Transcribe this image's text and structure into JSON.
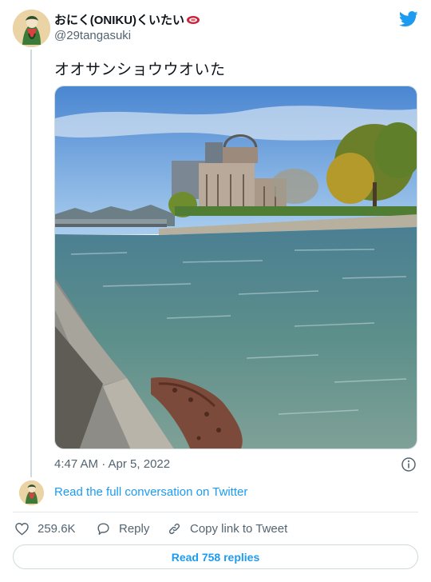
{
  "author": {
    "display_name": "おにく(ONIKU)くいたい",
    "handle": "@29tangasuki"
  },
  "tweet": {
    "text": "オオサンショウウオいた",
    "timestamp": "4:47 AM · Apr 5, 2022"
  },
  "conversation": {
    "read_full_label": "Read the full conversation on Twitter"
  },
  "actions": {
    "like_count": "259.6K",
    "reply_label": "Reply",
    "copy_link_label": "Copy link to Tweet"
  },
  "footer": {
    "read_replies_label": "Read 758 replies"
  },
  "icons": {
    "brand": "twitter-bird-icon",
    "like": "heart-icon",
    "reply": "speech-bubble-icon",
    "copy": "link-icon",
    "info": "info-icon",
    "name_emoji": "meat-icon"
  },
  "colors": {
    "accent": "#1d9bf0",
    "secondary_text": "#536471",
    "primary_text": "#0f1419",
    "border": "#cfd9de"
  }
}
